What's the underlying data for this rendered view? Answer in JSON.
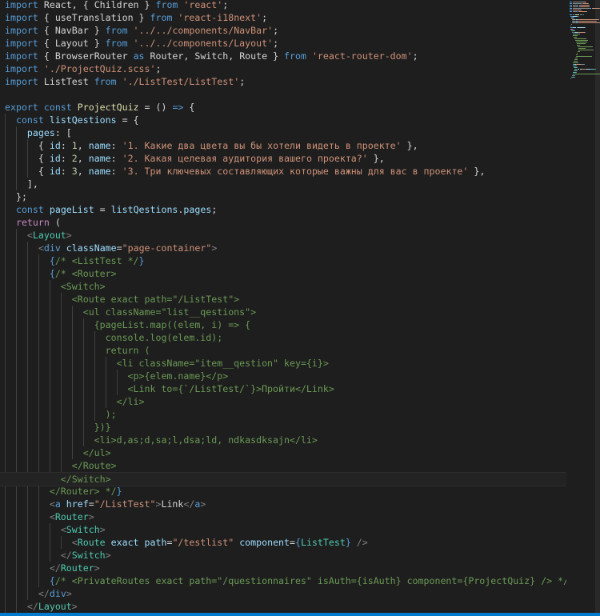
{
  "colors": {
    "background": "#1e1e1e",
    "status_bar": "#007acc"
  },
  "editor": {
    "language": "jsx",
    "cursor_line": 37,
    "lines": [
      [
        [
          "kw",
          "import"
        ],
        [
          "txt",
          " React, { Children } "
        ],
        [
          "kw",
          "from"
        ],
        [
          "str",
          " 'react'"
        ],
        [
          "txt",
          ";"
        ]
      ],
      [
        [
          "kw",
          "import"
        ],
        [
          "txt",
          " { useTranslation } "
        ],
        [
          "kw",
          "from"
        ],
        [
          "str",
          " 'react-i18next'"
        ],
        [
          "txt",
          ";"
        ]
      ],
      [
        [
          "kw",
          "import"
        ],
        [
          "txt",
          " { NavBar } "
        ],
        [
          "kw",
          "from"
        ],
        [
          "str",
          " '../../components/NavBar'"
        ],
        [
          "txt",
          ";"
        ]
      ],
      [
        [
          "kw",
          "import"
        ],
        [
          "txt",
          " { Layout } "
        ],
        [
          "kw",
          "from"
        ],
        [
          "str",
          " '../../components/Layout'"
        ],
        [
          "txt",
          ";"
        ]
      ],
      [
        [
          "kw",
          "import"
        ],
        [
          "txt",
          " { BrowserRouter "
        ],
        [
          "kw",
          "as"
        ],
        [
          "txt",
          " Router, Switch, Route } "
        ],
        [
          "kw",
          "from"
        ],
        [
          "str",
          " 'react-router-dom'"
        ],
        [
          "txt",
          ";"
        ]
      ],
      [
        [
          "kw",
          "import"
        ],
        [
          "str",
          " './ProjectQuiz.scss'"
        ],
        [
          "txt",
          ";"
        ]
      ],
      [
        [
          "kw",
          "import"
        ],
        [
          "txt",
          " ListTest "
        ],
        [
          "kw",
          "from"
        ],
        [
          "str",
          " './ListTest/ListTest'"
        ],
        [
          "txt",
          ";"
        ]
      ],
      [],
      [
        [
          "kw",
          "export"
        ],
        [
          "kw",
          " const"
        ],
        [
          "fn",
          " ProjectQuiz"
        ],
        [
          "txt",
          " = () "
        ],
        [
          "kw",
          "=>"
        ],
        [
          "txt",
          " {"
        ]
      ],
      [
        [
          "txt",
          "  "
        ],
        [
          "kw",
          "const"
        ],
        [
          "var",
          " listQestions"
        ],
        [
          "txt",
          " = {"
        ]
      ],
      [
        [
          "txt",
          "    "
        ],
        [
          "var",
          "pages"
        ],
        [
          "txt",
          ": ["
        ]
      ],
      [
        [
          "txt",
          "      { "
        ],
        [
          "var",
          "id"
        ],
        [
          "txt",
          ": "
        ],
        [
          "num",
          "1"
        ],
        [
          "txt",
          ", "
        ],
        [
          "var",
          "name"
        ],
        [
          "txt",
          ": "
        ],
        [
          "str",
          "'1. Какие два цвета вы бы хотели видеть в проекте'"
        ],
        [
          "txt",
          " },"
        ]
      ],
      [
        [
          "txt",
          "      { "
        ],
        [
          "var",
          "id"
        ],
        [
          "txt",
          ": "
        ],
        [
          "num",
          "2"
        ],
        [
          "txt",
          ", "
        ],
        [
          "var",
          "name"
        ],
        [
          "txt",
          ": "
        ],
        [
          "str",
          "'2. Какая целевая аудитория вашего проекта?'"
        ],
        [
          "txt",
          " },"
        ]
      ],
      [
        [
          "txt",
          "      { "
        ],
        [
          "var",
          "id"
        ],
        [
          "txt",
          ": "
        ],
        [
          "num",
          "3"
        ],
        [
          "txt",
          ", "
        ],
        [
          "var",
          "name"
        ],
        [
          "txt",
          ": "
        ],
        [
          "str",
          "'3. Три ключевых составляющих которые важны для вас в проекте'"
        ],
        [
          "txt",
          " },"
        ]
      ],
      [
        [
          "txt",
          "    ],"
        ]
      ],
      [
        [
          "txt",
          "  };"
        ]
      ],
      [
        [
          "txt",
          "  "
        ],
        [
          "kw",
          "const"
        ],
        [
          "var",
          " pageList"
        ],
        [
          "txt",
          " = "
        ],
        [
          "var",
          "listQestions"
        ],
        [
          "txt",
          "."
        ],
        [
          "var",
          "pages"
        ],
        [
          "txt",
          ";"
        ]
      ],
      [
        [
          "txt",
          "  "
        ],
        [
          "ctrl",
          "return"
        ],
        [
          "txt",
          " ("
        ]
      ],
      [
        [
          "txt",
          "    "
        ],
        [
          "br",
          "<"
        ],
        [
          "tag",
          "Layout"
        ],
        [
          "br",
          ">"
        ]
      ],
      [
        [
          "txt",
          "      "
        ],
        [
          "br",
          "<"
        ],
        [
          "kw",
          "div"
        ],
        [
          "var",
          " className"
        ],
        [
          "txt",
          "="
        ],
        [
          "str",
          "\"page-container\""
        ],
        [
          "br",
          ">"
        ]
      ],
      [
        [
          "txt",
          "        "
        ],
        [
          "kw",
          "{"
        ],
        [
          "com",
          "/* <ListTest */"
        ],
        [
          "kw",
          "}"
        ]
      ],
      [
        [
          "txt",
          "        "
        ],
        [
          "kw",
          "{"
        ],
        [
          "com",
          "/* <Router>"
        ]
      ],
      [
        [
          "com",
          "          <Switch>"
        ]
      ],
      [
        [
          "com",
          "            <Route exact path=\"/ListTest\">"
        ]
      ],
      [
        [
          "com",
          "              <ul className=\"list__qestions\">"
        ]
      ],
      [
        [
          "com",
          "                {pageList.map((elem, i) => {"
        ]
      ],
      [
        [
          "com",
          "                  console.log(elem.id);"
        ]
      ],
      [
        [
          "com",
          "                  return ("
        ]
      ],
      [
        [
          "com",
          "                    <li className=\"item__qestion\" key={i}>"
        ]
      ],
      [
        [
          "com",
          "                      <p>{elem.name}</p>"
        ]
      ],
      [
        [
          "com",
          "                      <Link to={`/ListTest/`}>Пройти</Link>"
        ]
      ],
      [
        [
          "com",
          "                    </li>"
        ]
      ],
      [
        [
          "com",
          "                  );"
        ]
      ],
      [
        [
          "com",
          "                })}"
        ]
      ],
      [
        [
          "com",
          "                <li>d,as;d,sa;l,dsa;ld, ndkasdksajn</li>"
        ]
      ],
      [
        [
          "com",
          "              </ul>"
        ]
      ],
      [
        [
          "com",
          "            </Route>"
        ]
      ],
      [
        [
          "com",
          "          </Switch>"
        ]
      ],
      [
        [
          "com",
          "        </Router> */"
        ],
        [
          "kw",
          "}"
        ]
      ],
      [
        [
          "txt",
          "        "
        ],
        [
          "br",
          "<"
        ],
        [
          "kw",
          "a"
        ],
        [
          "var",
          " href"
        ],
        [
          "txt",
          "="
        ],
        [
          "str",
          "\"/ListTest\""
        ],
        [
          "br",
          ">"
        ],
        [
          "txt",
          "Link"
        ],
        [
          "br",
          "</"
        ],
        [
          "kw",
          "a"
        ],
        [
          "br",
          ">"
        ]
      ],
      [
        [
          "txt",
          "        "
        ],
        [
          "br",
          "<"
        ],
        [
          "tag",
          "Router"
        ],
        [
          "br",
          ">"
        ]
      ],
      [
        [
          "txt",
          "          "
        ],
        [
          "br",
          "<"
        ],
        [
          "tag",
          "Switch"
        ],
        [
          "br",
          ">"
        ]
      ],
      [
        [
          "txt",
          "            "
        ],
        [
          "br",
          "<"
        ],
        [
          "tag",
          "Route"
        ],
        [
          "var",
          " exact"
        ],
        [
          "var",
          " path"
        ],
        [
          "txt",
          "="
        ],
        [
          "str",
          "\"/testlist\""
        ],
        [
          "var",
          " component"
        ],
        [
          "txt",
          "="
        ],
        [
          "kw",
          "{"
        ],
        [
          "tag",
          "ListTest"
        ],
        [
          "kw",
          "}"
        ],
        [
          "br",
          " />"
        ]
      ],
      [
        [
          "txt",
          "          "
        ],
        [
          "br",
          "</"
        ],
        [
          "tag",
          "Switch"
        ],
        [
          "br",
          ">"
        ]
      ],
      [
        [
          "txt",
          "        "
        ],
        [
          "br",
          "</"
        ],
        [
          "tag",
          "Router"
        ],
        [
          "br",
          ">"
        ]
      ],
      [
        [
          "txt",
          "        "
        ],
        [
          "kw",
          "{"
        ],
        [
          "com",
          "/* <PrivateRoutes exact path=\"/questionnaires\" isAuth={isAuth} component={ProjectQuiz} /> */"
        ],
        [
          "kw",
          "}"
        ]
      ],
      [
        [
          "txt",
          "      "
        ],
        [
          "br",
          "</"
        ],
        [
          "kw",
          "div"
        ],
        [
          "br",
          ">"
        ]
      ],
      [
        [
          "txt",
          "    "
        ],
        [
          "br",
          "</"
        ],
        [
          "tag",
          "Layout"
        ],
        [
          "br",
          ">"
        ]
      ],
      [
        [
          "txt",
          "  );"
        ]
      ]
    ]
  }
}
